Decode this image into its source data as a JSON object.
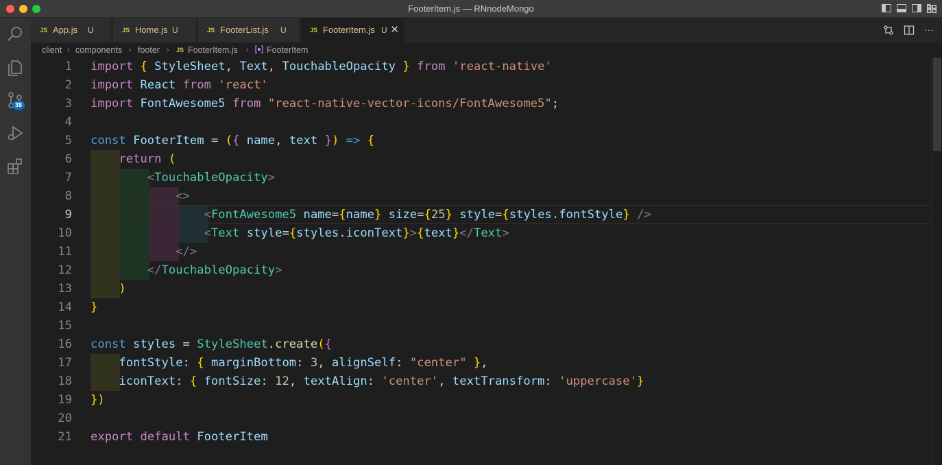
{
  "window": {
    "title": "FooterItem.js — RNnodeMongo"
  },
  "activity_bar": {
    "scm_badge": "38"
  },
  "tabs": [
    {
      "icon": "JS",
      "label": "App.js",
      "status": "U"
    },
    {
      "icon": "JS",
      "label": "Home.js",
      "status": "U"
    },
    {
      "icon": "JS",
      "label": "FooterList.js",
      "status": "U"
    },
    {
      "icon": "JS",
      "label": "FooterItem.js",
      "status": "U",
      "active": true
    }
  ],
  "breadcrumb": {
    "items": [
      "client",
      "components",
      "footer"
    ],
    "file_icon": "JS",
    "file": "FooterItem.js",
    "symbol": "FooterItem"
  },
  "editor": {
    "current_line": 9,
    "line_numbers": [
      "1",
      "2",
      "3",
      "4",
      "5",
      "6",
      "7",
      "8",
      "9",
      "10",
      "11",
      "12",
      "13",
      "14",
      "15",
      "16",
      "17",
      "18",
      "19",
      "20",
      "21"
    ],
    "lines": [
      "import { StyleSheet, Text, TouchableOpacity } from 'react-native'",
      "import React from 'react'",
      "import FontAwesome5 from \"react-native-vector-icons/FontAwesome5\";",
      "",
      "const FooterItem = ({ name, text }) => {",
      "    return (",
      "        <TouchableOpacity>",
      "            <>",
      "                <FontAwesome5 name={name} size={25} style={styles.fontStyle} />",
      "                <Text style={styles.iconText}>{text}</Text>",
      "            </>",
      "        </TouchableOpacity>",
      "    )",
      "}",
      "",
      "const styles = StyleSheet.create({",
      "    fontStyle: { marginBottom: 3, alignSelf: \"center\" },",
      "    iconText: { fontSize: 12, textAlign: 'center', textTransform: 'uppercase'}",
      "})",
      "",
      "export default FooterItem"
    ]
  }
}
